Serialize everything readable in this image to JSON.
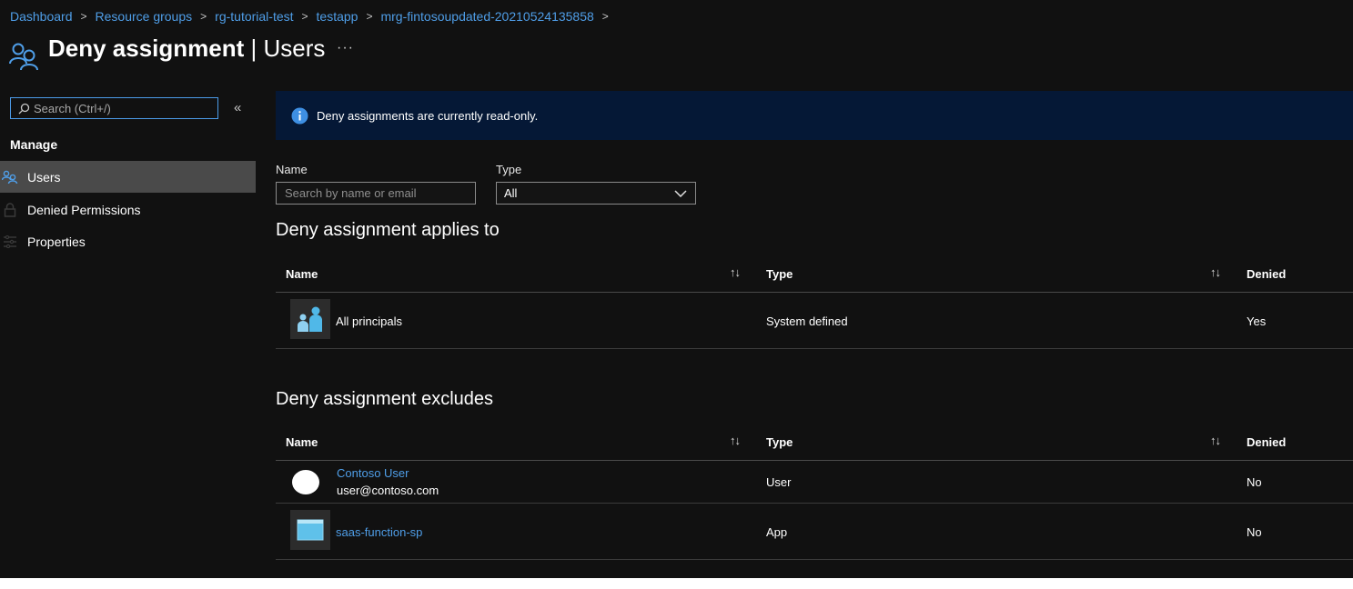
{
  "breadcrumb": [
    "Dashboard",
    "Resource groups",
    "rg-tutorial-test",
    "testapp",
    "mrg-fintosoupdated-20210524135858"
  ],
  "header": {
    "title_main": "Deny assignment",
    "title_sep": " | ",
    "title_sub": "Users",
    "more": "···"
  },
  "sidebar": {
    "search_placeholder": "Search (Ctrl+/)",
    "collapse": "«",
    "section": "Manage",
    "items": [
      {
        "label": "Users",
        "icon": "users-icon",
        "active": true
      },
      {
        "label": "Denied Permissions",
        "icon": "lock-icon",
        "active": false
      },
      {
        "label": "Properties",
        "icon": "properties-icon",
        "active": false
      }
    ]
  },
  "banner": {
    "text": "Deny assignments are currently read-only.",
    "icon": "info-icon"
  },
  "filters": {
    "name_label": "Name",
    "name_placeholder": "Search by name or email",
    "type_label": "Type",
    "type_value": "All"
  },
  "applies_to": {
    "title": "Deny assignment applies to",
    "columns": [
      "Name",
      "Type",
      "Denied"
    ],
    "rows": [
      {
        "name": "All principals",
        "type": "System defined",
        "denied": "Yes",
        "icon": "all-principals-icon"
      }
    ]
  },
  "excludes": {
    "title": "Deny assignment excludes",
    "columns": [
      "Name",
      "Type",
      "Denied"
    ],
    "rows": [
      {
        "name": "Contoso User",
        "email": "user@contoso.com",
        "type": "User",
        "denied": "No",
        "icon": "user-avatar"
      },
      {
        "name": "saas-function-sp",
        "type": "App",
        "denied": "No",
        "icon": "app-icon"
      }
    ]
  },
  "sort_glyph": "↑↓",
  "colors": {
    "link": "#4f9ee8",
    "background": "#111111",
    "banner": "#051836",
    "active_nav": "#4a4a4a"
  }
}
